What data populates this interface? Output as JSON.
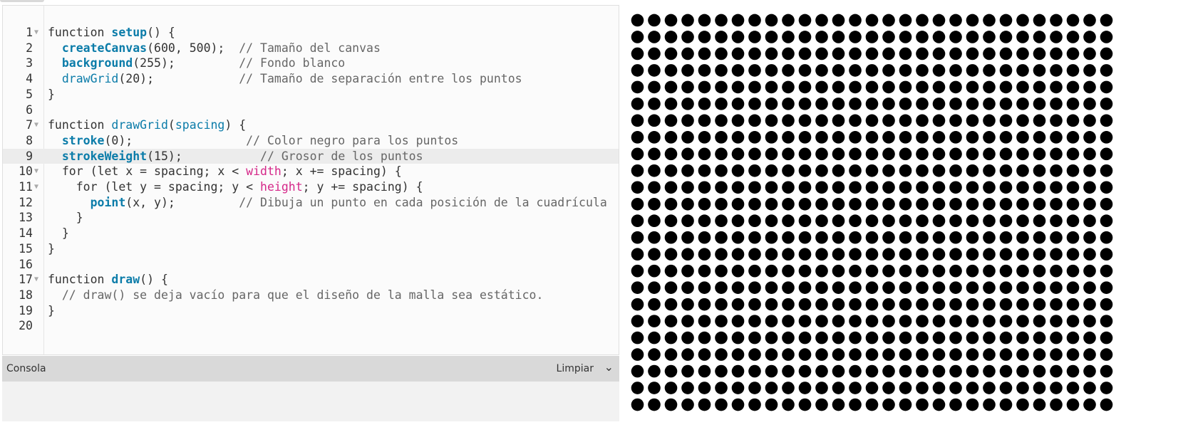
{
  "editor": {
    "lines": [
      {
        "n": "1",
        "fold": true,
        "tokens": [
          [
            "function ",
            ""
          ],
          [
            "setup",
            "kw"
          ],
          [
            "() {",
            ""
          ]
        ]
      },
      {
        "n": "2",
        "tokens": [
          [
            "  ",
            ""
          ],
          [
            "createCanvas",
            "kw"
          ],
          [
            "(600, 500);  ",
            ""
          ],
          [
            "// Tamaño del canvas",
            "cm"
          ]
        ]
      },
      {
        "n": "3",
        "tokens": [
          [
            "  ",
            ""
          ],
          [
            "background",
            "kw"
          ],
          [
            "(255);         ",
            ""
          ],
          [
            "// Fondo blanco",
            "cm"
          ]
        ]
      },
      {
        "n": "4",
        "tokens": [
          [
            "  ",
            ""
          ],
          [
            "drawGrid",
            "fn"
          ],
          [
            "(20);            ",
            ""
          ],
          [
            "// Tamaño de separación entre los puntos",
            "cm"
          ]
        ]
      },
      {
        "n": "5",
        "tokens": [
          [
            "}",
            ""
          ]
        ]
      },
      {
        "n": "6",
        "tokens": []
      },
      {
        "n": "7",
        "fold": true,
        "tokens": [
          [
            "function ",
            ""
          ],
          [
            "drawGrid",
            "fn"
          ],
          [
            "(",
            ""
          ],
          [
            "spacing",
            "fn"
          ],
          [
            ") {",
            ""
          ]
        ]
      },
      {
        "n": "8",
        "tokens": [
          [
            "  ",
            ""
          ],
          [
            "stroke",
            "kw"
          ],
          [
            "(0);                ",
            ""
          ],
          [
            "// Color negro para los puntos",
            "cm"
          ]
        ]
      },
      {
        "n": "9",
        "hl": true,
        "tokens": [
          [
            "  ",
            ""
          ],
          [
            "strokeWeight",
            "kw"
          ],
          [
            "(15);           ",
            ""
          ],
          [
            "// Grosor de los puntos",
            "cm"
          ]
        ]
      },
      {
        "n": "10",
        "fold": true,
        "tokens": [
          [
            "  for (let x = spacing; x < ",
            ""
          ],
          [
            "width",
            "var"
          ],
          [
            "; x += spacing) {",
            ""
          ]
        ]
      },
      {
        "n": "11",
        "fold": true,
        "tokens": [
          [
            "    for (let y = spacing; y < ",
            ""
          ],
          [
            "height",
            "var"
          ],
          [
            "; y += spacing) {",
            ""
          ]
        ]
      },
      {
        "n": "12",
        "tokens": [
          [
            "      ",
            ""
          ],
          [
            "point",
            "kw"
          ],
          [
            "(x, y);         ",
            ""
          ],
          [
            "// Dibuja un punto en cada posición de la cuadrícula",
            "cm"
          ]
        ]
      },
      {
        "n": "13",
        "tokens": [
          [
            "    }",
            ""
          ]
        ]
      },
      {
        "n": "14",
        "tokens": [
          [
            "  }",
            ""
          ]
        ]
      },
      {
        "n": "15",
        "tokens": [
          [
            "}",
            ""
          ]
        ]
      },
      {
        "n": "16",
        "tokens": []
      },
      {
        "n": "17",
        "fold": true,
        "tokens": [
          [
            "function ",
            ""
          ],
          [
            "draw",
            "kw"
          ],
          [
            "() {",
            ""
          ]
        ]
      },
      {
        "n": "18",
        "tokens": [
          [
            "  ",
            ""
          ],
          [
            "// draw() se deja vacío para que el diseño de la malla sea estático.",
            "cm"
          ]
        ]
      },
      {
        "n": "19",
        "tokens": [
          [
            "}",
            ""
          ]
        ]
      },
      {
        "n": "20",
        "tokens": []
      }
    ]
  },
  "console": {
    "title": "Consola",
    "clear_label": "Limpiar",
    "collapse_icon": "chevron-down-icon"
  },
  "sketch": {
    "canvas_width": 600,
    "canvas_height": 500,
    "background": "#ffffff",
    "dot_color": "#000000",
    "spacing": 20,
    "stroke_weight": 15
  }
}
